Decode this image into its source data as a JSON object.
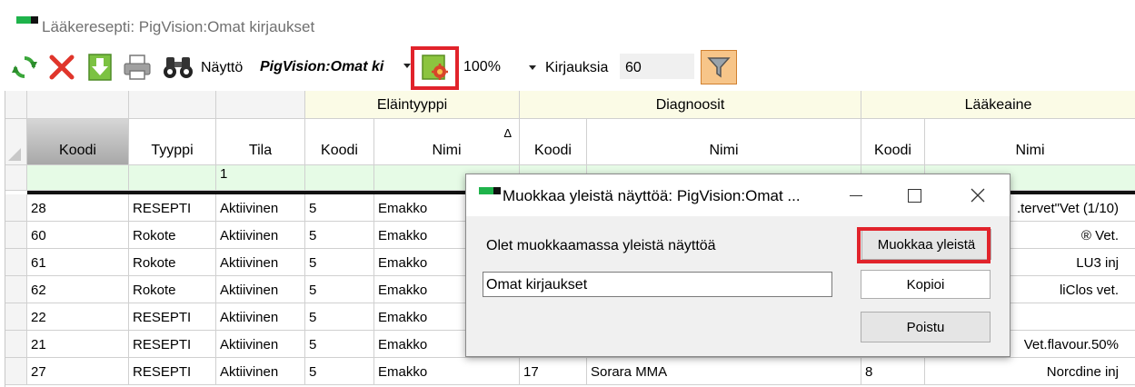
{
  "app": {
    "title": "Lääkeresepti: PigVision:Omat kirjaukset"
  },
  "toolbar": {
    "icons": [
      "refresh-icon",
      "delete-icon",
      "download-icon",
      "print-icon",
      "binoculars-icon"
    ],
    "view_label": "Näyttö",
    "view_value": "PigVision:Omat ki",
    "zoom_value": "100%",
    "count_label": "Kirjauksia",
    "count_value": "60"
  },
  "grid": {
    "groups": [
      "Eläintyyppi",
      "Diagnoosit",
      "Lääkeaine"
    ],
    "columns": [
      "Koodi",
      "Tyyppi",
      "Tila",
      "Koodi",
      "Nimi",
      "Koodi",
      "Nimi",
      "Koodi",
      "Nimi"
    ],
    "filter_row": [
      "",
      "",
      "1",
      "",
      "",
      "",
      "",
      "",
      ""
    ],
    "sort_indicator": "Δ",
    "rows": [
      [
        "28",
        "RESEPTI",
        "Aktiivinen",
        "5",
        "Emakko",
        "",
        "",
        "",
        ".tervet\"Vet (1/10)"
      ],
      [
        "60",
        "Rokote",
        "Aktiivinen",
        "5",
        "Emakko",
        "",
        "",
        "",
        "® Vet."
      ],
      [
        "61",
        "Rokote",
        "Aktiivinen",
        "5",
        "Emakko",
        "",
        "",
        "",
        "LU3 inj"
      ],
      [
        "62",
        "Rokote",
        "Aktiivinen",
        "5",
        "Emakko",
        "",
        "",
        "",
        "liClos vet."
      ],
      [
        "22",
        "RESEPTI",
        "Aktiivinen",
        "5",
        "Emakko",
        "",
        "",
        "",
        ""
      ],
      [
        "21",
        "RESEPTI",
        "Aktiivinen",
        "5",
        "Emakko",
        "",
        "",
        "",
        "Vet.flavour.50%"
      ],
      [
        "27",
        "RESEPTI",
        "Aktiivinen",
        "5",
        "Emakko",
        "17",
        "Sorara MMA",
        "8",
        "Norcdine inj"
      ]
    ]
  },
  "dialog": {
    "title": "Muokkaa yleistä näyttöä: PigVision:Omat ...",
    "prompt": "Olet muokkaamassa yleistä näyttöä",
    "name_value": "Omat kirjaukset",
    "edit_label": "Muokkaa yleistä",
    "copy_label": "Kopioi",
    "delete_label": "Poistu"
  },
  "colors": {
    "group_header_bg": "#fbfbe6",
    "filter_row_bg": "#e6fbe6",
    "selected_header_bg": "#b8b8b8",
    "highlight": "#e1232b"
  }
}
